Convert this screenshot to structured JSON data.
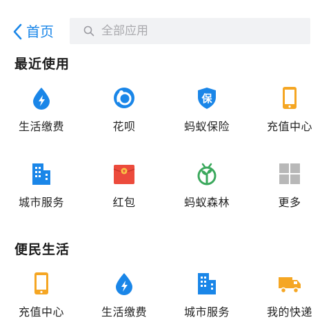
{
  "header": {
    "back_label": "首页",
    "search_placeholder": "全部应用"
  },
  "sections": [
    {
      "title": "最近使用",
      "items": [
        {
          "label": "生活缴费",
          "icon": "water-drop-bolt-icon"
        },
        {
          "label": "花呗",
          "icon": "huabei-icon"
        },
        {
          "label": "蚂蚁保险",
          "icon": "insurance-shield-icon"
        },
        {
          "label": "充值中心",
          "icon": "phone-topup-icon"
        },
        {
          "label": "城市服务",
          "icon": "city-buildings-icon"
        },
        {
          "label": "红包",
          "icon": "red-envelope-icon"
        },
        {
          "label": "蚂蚁森林",
          "icon": "sprout-icon"
        },
        {
          "label": "更多",
          "icon": "grid-more-icon"
        }
      ]
    },
    {
      "title": "便民生活",
      "items": [
        {
          "label": "充值中心",
          "icon": "phone-topup-icon"
        },
        {
          "label": "生活缴费",
          "icon": "water-drop-bolt-icon"
        },
        {
          "label": "城市服务",
          "icon": "city-buildings-icon"
        },
        {
          "label": "我的快递",
          "icon": "delivery-truck-icon"
        }
      ]
    }
  ],
  "colors": {
    "accent_blue": "#1a86e8",
    "orange": "#f5a623",
    "red": "#ec4b3c",
    "green": "#3aa85c",
    "gray": "#b8b8b8"
  }
}
